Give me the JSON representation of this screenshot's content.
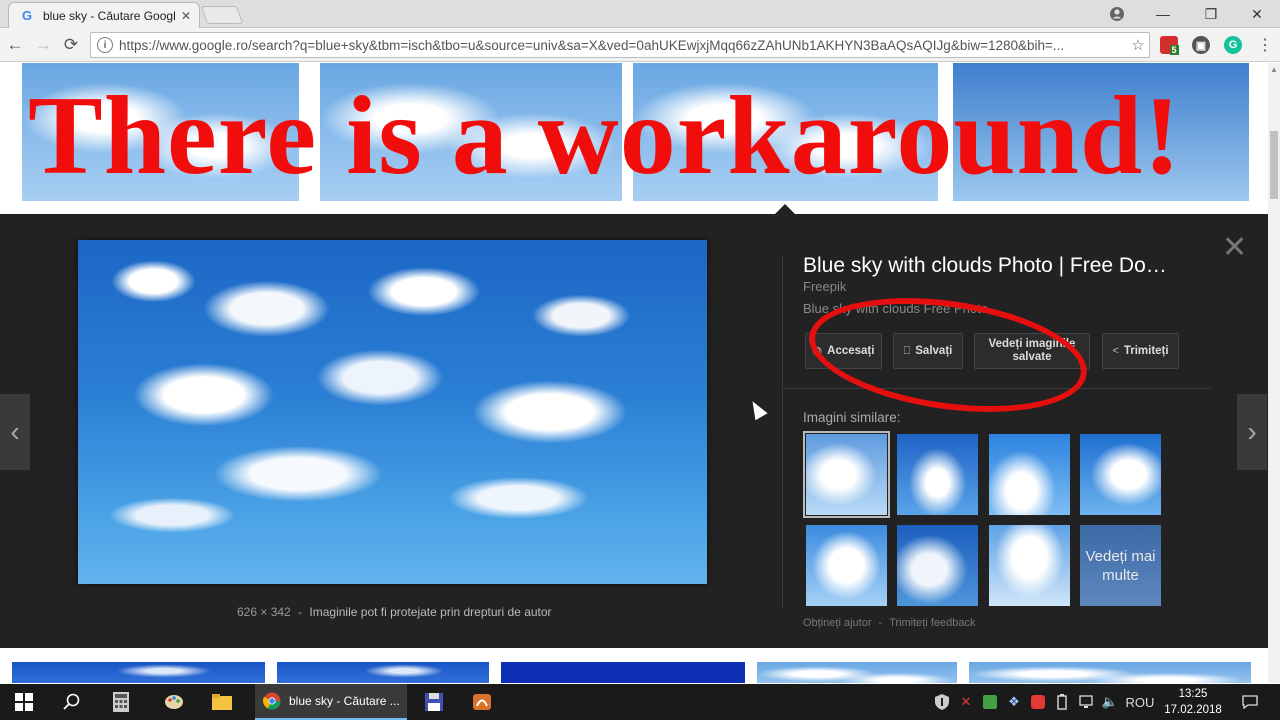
{
  "browser": {
    "tab_title": "blue sky - Căutare Googl",
    "tab_favicon": "G",
    "url": "https://www.google.ro/search?q=blue+sky&tbm=isch&tbo=u&source=univ&sa=X&ved=0ahUKEwjxjMqq66zZAhUNb1AKHYN3BaAQsAQIJg&biw=1280&bih=...",
    "window_controls": {
      "minimize": "—",
      "restore": "❐",
      "close": "✕"
    },
    "nav": {
      "back": "←",
      "forward": "→",
      "reload": "⟳"
    },
    "icons": [
      "account-icon",
      "star-icon",
      "ext-shield-icon",
      "ext-film-icon",
      "ext-grammarly-icon",
      "menu-icon"
    ],
    "ext_badge": "5",
    "grammarly": "G"
  },
  "overlay_text": "There is a workaround!",
  "image_panel": {
    "title": "Blue sky with clouds Photo | Free Do…",
    "source": "Freepik",
    "description": "Blue sky with clouds Free Photo",
    "dimensions": "626 × 342",
    "separator": "-",
    "copyright": "Imaginile pot fi protejate prin drepturi de autor",
    "close": "✕",
    "buttons": {
      "visit": "Accesați",
      "save": "Salvați",
      "view_saved": "Vedeți imaginile salvate",
      "share": "Trimiteți"
    },
    "similar_label": "Imagini similare:",
    "more": "Vedeți mai multe",
    "help": "Obțineți ajutor",
    "feedback": "Trimiteți feedback",
    "footer_sep": "-",
    "prev": "‹",
    "next": "›"
  },
  "taskbar": {
    "app_label": "blue sky - Căutare ...",
    "language": "ROU",
    "time": "13:25",
    "date": "17.02.2018",
    "colors": {
      "active_underline": "#76b9ed"
    }
  },
  "colors": {
    "overlay_red": "#f20d0d",
    "panel_bg": "#222222",
    "ellipse_red": "#e60f0f"
  }
}
